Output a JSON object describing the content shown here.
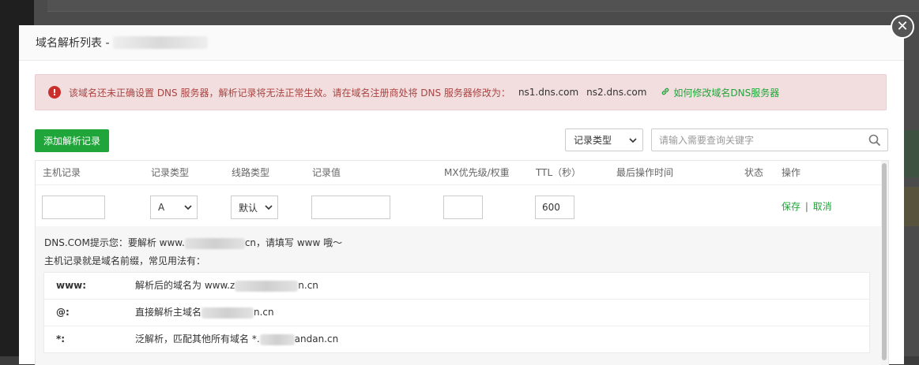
{
  "modal": {
    "title": "域名解析列表 -",
    "close": "✕"
  },
  "alert": {
    "icon": "!",
    "message": "该域名还未正确设置 DNS 服务器，解析记录将无法正常生效。请在域名注册商处将 DNS 服务器修改为：",
    "ns1": "ns1.dns.com",
    "ns2": "ns2.dns.com",
    "link": "如何修改域名DNS服务器"
  },
  "toolbar": {
    "add_label": "添加解析记录",
    "type_select": "记录类型",
    "search_placeholder": "请输入需要查询关键字"
  },
  "table": {
    "headers": [
      "主机记录",
      "记录类型",
      "线路类型",
      "记录值",
      "MX优先级/权重",
      "TTL（秒）",
      "最后操作时间",
      "状态",
      "操作"
    ]
  },
  "edit_row": {
    "host": "",
    "type": "A",
    "line": "默认",
    "value": "",
    "mx": "",
    "ttl": "600",
    "save": "保存",
    "sep": "|",
    "cancel": "取消"
  },
  "tips": {
    "line1_prefix": "DNS.COM提示您：要解析 www.",
    "line1_suffix": "cn，请填写 www 哦～",
    "line2": "主机记录就是域名前缀，常见用法有：",
    "examples": [
      {
        "key": "www:",
        "value_prefix": "解析后的域名为 www.z",
        "value_suffix": "n.cn"
      },
      {
        "key": "@:",
        "value_prefix": "直接解析主域名",
        "value_suffix": "n.cn"
      },
      {
        "key": "*:",
        "value_prefix": "泛解析，匹配其他所有域名 *.",
        "value_suffix": "andan.cn"
      }
    ]
  },
  "colors": {
    "accent": "#20a53a",
    "alert_bg": "#f2dede",
    "alert_text": "#a94442"
  }
}
